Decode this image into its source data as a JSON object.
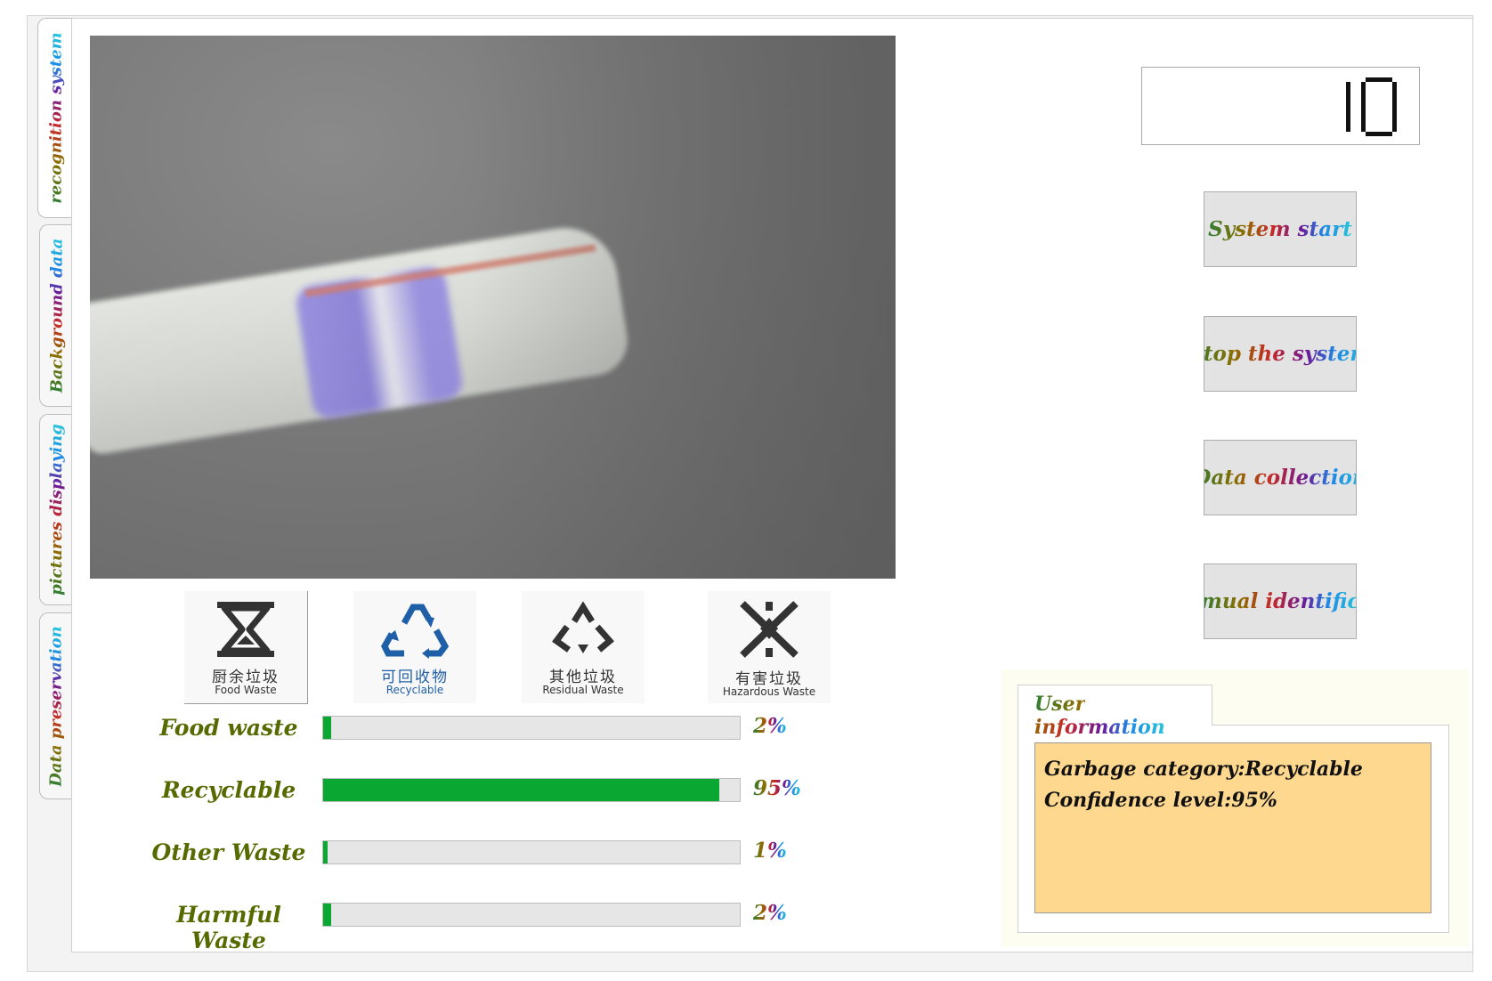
{
  "tabs": [
    {
      "label": "recognition system",
      "active": true
    },
    {
      "label": "Background data",
      "active": false
    },
    {
      "label": "pictures displaying",
      "active": false
    },
    {
      "label": "Data preservation",
      "active": false
    }
  ],
  "counter_display": "10",
  "buttons": {
    "system_start": "System start",
    "stop_system": "Stop the system",
    "data_collection": "Data collection",
    "manual_identification": "mual identific"
  },
  "icons": [
    {
      "name": "food-waste-icon",
      "cn": "厨余垃圾",
      "en": "Food Waste",
      "color": "#333333"
    },
    {
      "name": "recyclable-icon",
      "cn": "可回收物",
      "en": "Recyclable",
      "color": "#1f5fa8"
    },
    {
      "name": "residual-waste-icon",
      "cn": "其他垃圾",
      "en": "Residual Waste",
      "color": "#333333"
    },
    {
      "name": "hazardous-waste-icon",
      "cn": "有害垃圾",
      "en": "Hazardous Waste",
      "color": "#333333"
    }
  ],
  "categories": [
    {
      "label": "Food waste",
      "percent_text": "2%",
      "value": 2
    },
    {
      "label": "Recyclable",
      "percent_text": "95%",
      "value": 95
    },
    {
      "label": "Other Waste",
      "percent_text": "1%",
      "value": 1
    },
    {
      "label": "Harmful Waste",
      "percent_text": "2%",
      "value": 2
    }
  ],
  "user_info": {
    "tab_label": "User information",
    "line1": "Garbage category:Recyclable",
    "line2": "Confidence level:95%"
  },
  "colors": {
    "progress_fill": "#0aa832",
    "info_box_bg": "#ffd890",
    "category_label": "#556b00"
  }
}
